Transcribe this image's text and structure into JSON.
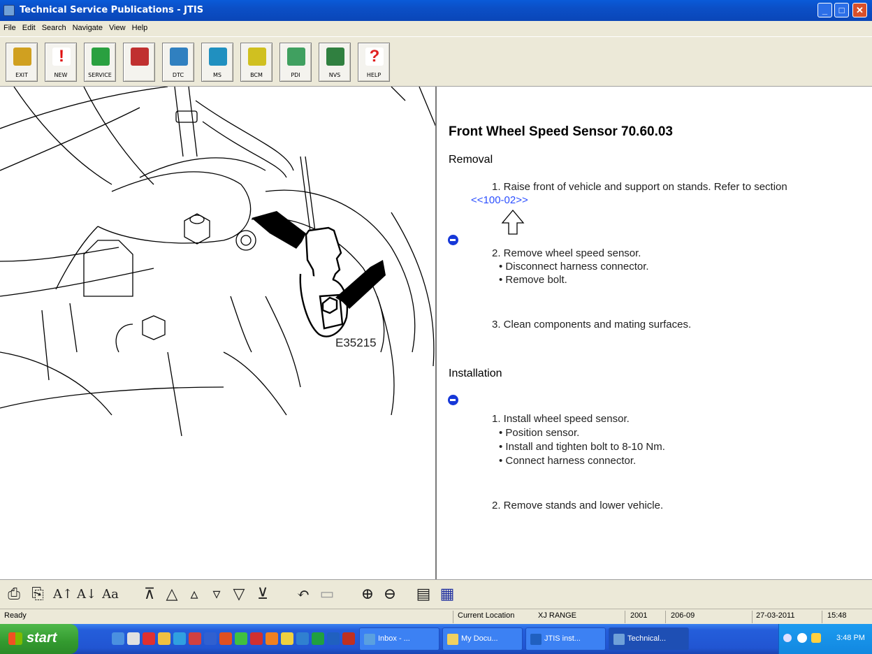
{
  "window": {
    "title": "Technical Service Publications - JTIS",
    "controls": [
      "_",
      "□",
      "✕"
    ]
  },
  "menu": [
    "File",
    "Edit",
    "Search",
    "Navigate",
    "View",
    "Help"
  ],
  "toolbar": [
    {
      "label": "EXIT",
      "icon": "exit-door-icon",
      "color": "#d0a020"
    },
    {
      "label": "NEW",
      "icon": "new-exclamation-icon",
      "color": "#e01010"
    },
    {
      "label": "SERVICE",
      "icon": "service-tools-icon",
      "color": "#2aa040"
    },
    {
      "label": "",
      "icon": "maple-leaf-icon",
      "color": "#c03030"
    },
    {
      "label": "DTC",
      "icon": "dtc-icon",
      "color": "#3080c0"
    },
    {
      "label": "MS",
      "icon": "ms-icon",
      "color": "#2090c0"
    },
    {
      "label": "BCM",
      "icon": "bcm-icon",
      "color": "#d0c020"
    },
    {
      "label": "PDI",
      "icon": "pdi-car-icon",
      "color": "#40a060"
    },
    {
      "label": "NVS",
      "icon": "nvs-car-icon",
      "color": "#308040"
    },
    {
      "label": "HELP",
      "icon": "help-question-icon",
      "color": "#e02020"
    }
  ],
  "illustration": {
    "code": "E35215"
  },
  "document": {
    "title": "Front Wheel Speed Sensor 70.60.03",
    "removal_heading": "Removal",
    "removal_step1": "1. Raise front of vehicle and support on stands. Refer to section",
    "removal_step1_link": "<<100-02>>",
    "removal_step2": "2. Remove wheel speed sensor.",
    "removal_step2_sub1": "• Disconnect harness connector.",
    "removal_step2_sub2": "• Remove bolt.",
    "removal_step3": "3. Clean components and mating surfaces.",
    "installation_heading": "Installation",
    "install_step1": "1. Install wheel speed sensor.",
    "install_step1_sub1": "• Position sensor.",
    "install_step1_sub2": "• Install and tighten bolt to 8-10 Nm.",
    "install_step1_sub3": "• Connect harness connector.",
    "install_step2": "2. Remove stands and lower vehicle."
  },
  "bottom_toolbar": [
    {
      "glyph": "⎙",
      "icon": "print-icon"
    },
    {
      "glyph": "⎘",
      "icon": "copy-icon"
    },
    {
      "glyph": "A↑",
      "icon": "font-increase-icon"
    },
    {
      "glyph": "A↓",
      "icon": "font-decrease-icon"
    },
    {
      "glyph": "Aa",
      "icon": "font-icon"
    },
    {
      "glyph": "⊼",
      "icon": "first-page-icon"
    },
    {
      "glyph": "△",
      "icon": "prev-page-icon"
    },
    {
      "glyph": "▵",
      "icon": "prev-icon"
    },
    {
      "glyph": "▿",
      "icon": "next-icon"
    },
    {
      "glyph": "▽",
      "icon": "next-page-icon"
    },
    {
      "glyph": "⊻",
      "icon": "last-page-icon"
    },
    {
      "glyph": "↶",
      "icon": "back-icon"
    },
    {
      "glyph": "▭",
      "icon": "forward-icon"
    },
    {
      "glyph": "⊕",
      "icon": "zoom-in-icon"
    },
    {
      "glyph": "⊖",
      "icon": "zoom-out-icon"
    },
    {
      "glyph": "▤",
      "icon": "page-icon"
    },
    {
      "glyph": "▦",
      "icon": "layout-icon"
    }
  ],
  "status": {
    "ready": "Ready",
    "current_location_label": "Current Location",
    "location": "XJ RANGE",
    "year": "2001",
    "section": "206-09",
    "date": "27-03-2011",
    "time": "15:48"
  },
  "taskbar": {
    "start_label": "start",
    "tasks": [
      {
        "label": "Inbox - ...",
        "icon_color": "#5aa0e0"
      },
      {
        "label": "My Docu...",
        "icon_color": "#f0d060"
      },
      {
        "label": "JTIS inst...",
        "icon_color": "#2060c0"
      },
      {
        "label": "Technical...",
        "icon_color": "#6fa0d8"
      }
    ],
    "clock": "3:48 PM"
  },
  "colors": {
    "title_bar": "#0a4fc6",
    "link": "#2b4fff",
    "nav_bullet": "#1638d8",
    "chrome": "#ece9d8"
  }
}
